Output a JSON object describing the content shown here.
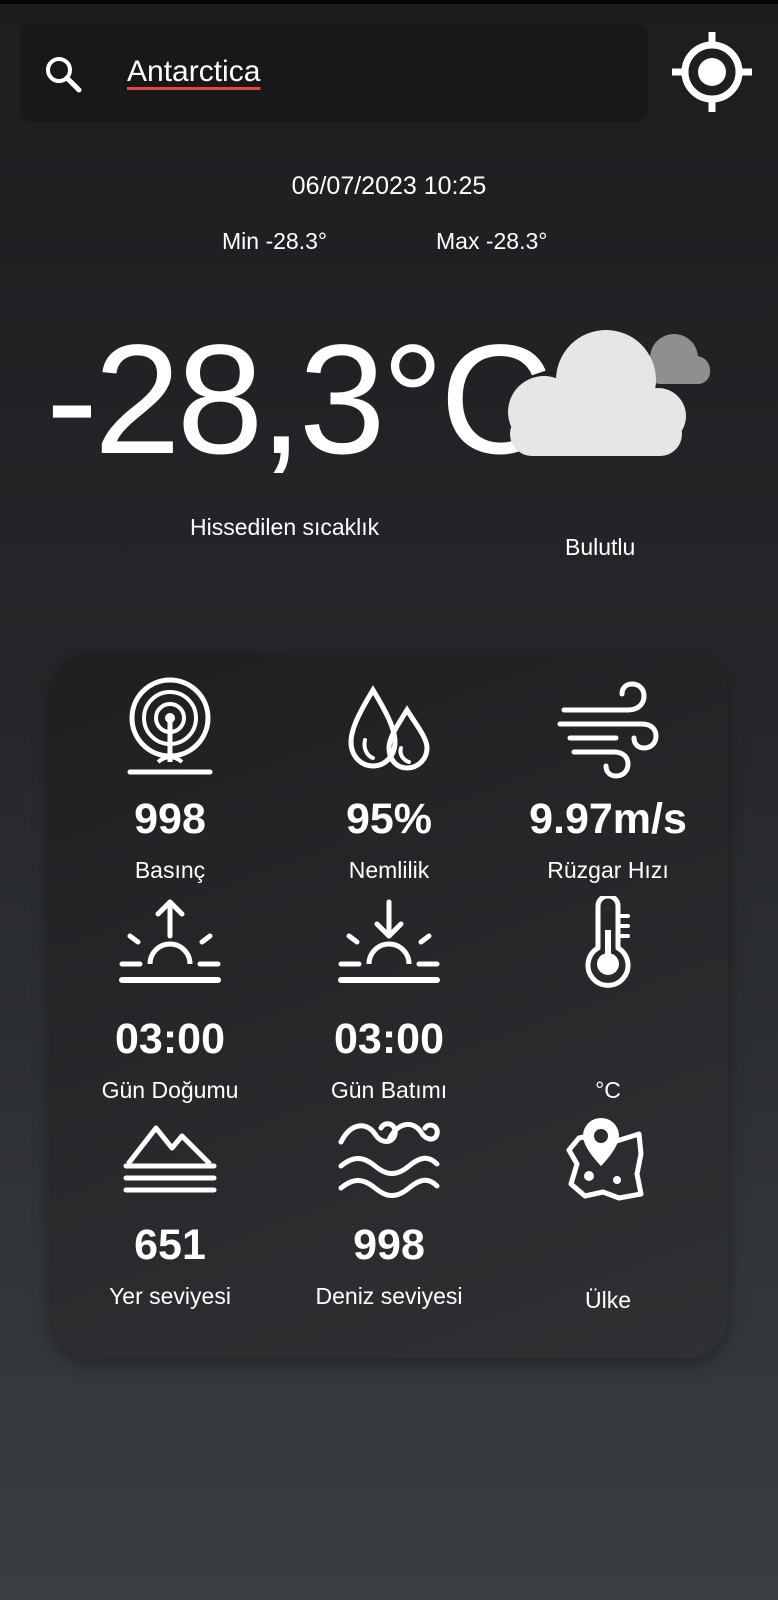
{
  "search": {
    "value": "Antarctica"
  },
  "datetime": "06/07/2023 10:25",
  "min_temp": "Min -28.3°",
  "max_temp": "Max -28.3°",
  "temperature": "-28,3°C",
  "feels_like_label": "Hissedilen sıcaklık",
  "condition": "Bulutlu",
  "stats": {
    "pressure": {
      "value": "998",
      "label": "Basınç",
      "icon": "barometer-icon"
    },
    "humidity": {
      "value": "95%",
      "label": "Nemlilik",
      "icon": "humidity-drops-icon"
    },
    "wind": {
      "value": "9.97m/s",
      "label": "Rüzgar Hızı",
      "icon": "wind-icon"
    },
    "sunrise": {
      "value": "03:00",
      "label": "Gün Doğumu",
      "icon": "sunrise-icon"
    },
    "sunset": {
      "value": "03:00",
      "label": "Gün Batımı",
      "icon": "sunset-icon"
    },
    "unit": {
      "value": "",
      "label": "°C",
      "icon": "thermometer-icon"
    },
    "ground_level": {
      "value": "651",
      "label": "Yer seviyesi",
      "icon": "mountain-icon"
    },
    "sea_level": {
      "value": "998",
      "label": "Deniz seviyesi",
      "icon": "waves-icon"
    },
    "country": {
      "value": "",
      "label": "Ülke",
      "icon": "map-pin-icon"
    }
  }
}
